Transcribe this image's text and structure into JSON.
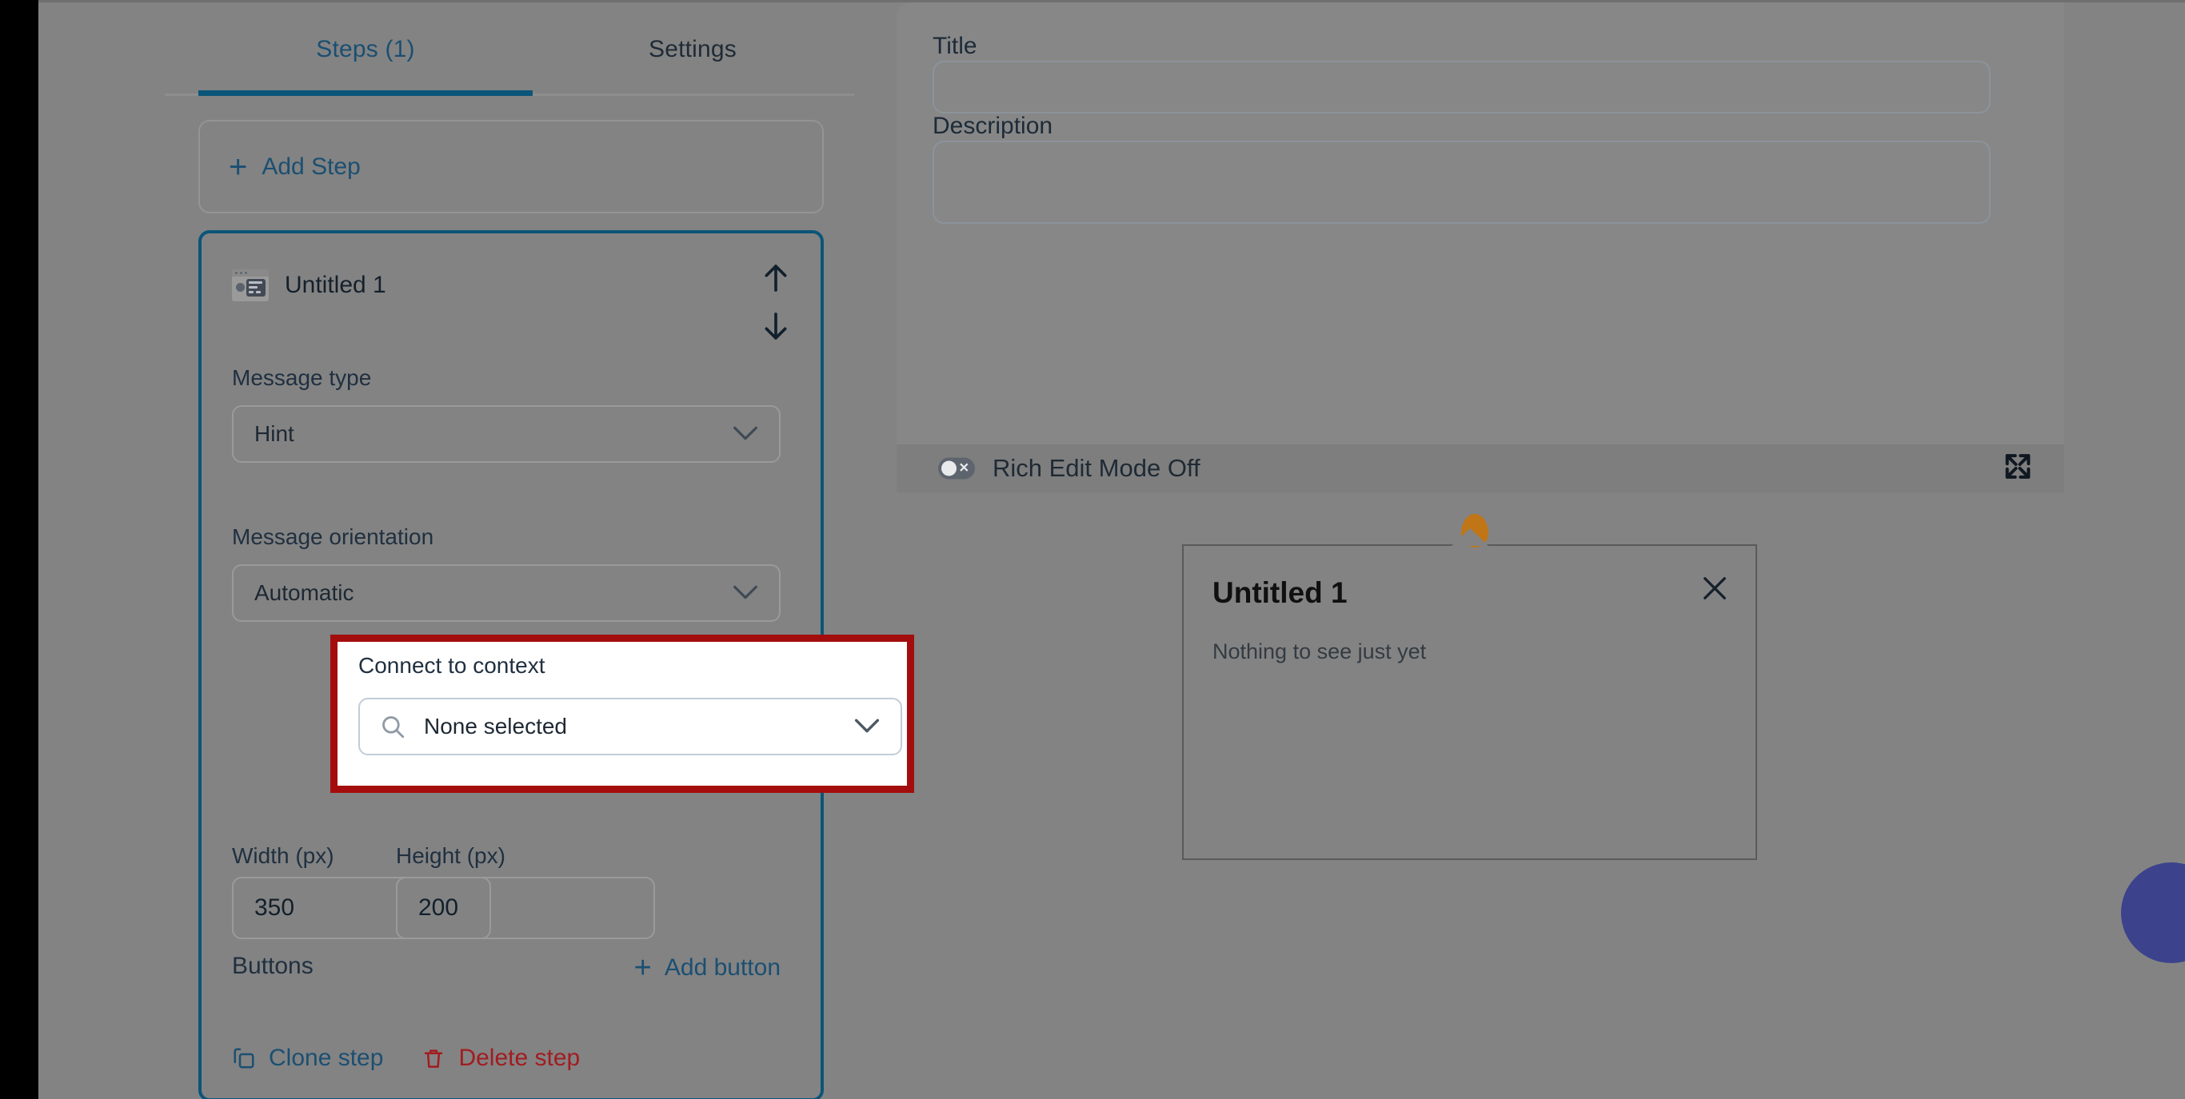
{
  "tabs": [
    {
      "label": "Steps (1)",
      "active": true
    },
    {
      "label": "Settings",
      "active": false
    }
  ],
  "left_panel": {
    "add_step_label": "Add Step",
    "step": {
      "name": "Untitled 1",
      "icon": "hint-window-icon",
      "move_up_icon": "arrow-up-icon",
      "move_down_icon": "arrow-down-icon",
      "message_type": {
        "label": "Message type",
        "value": "Hint"
      },
      "message_orientation": {
        "label": "Message orientation",
        "value": "Automatic"
      },
      "connect_to_context": {
        "label": "Connect to context",
        "value": "None selected",
        "search_icon": "search-icon",
        "highlighted": true,
        "highlight_color": "#a40d0d"
      },
      "width": {
        "label": "Width (px)",
        "value": "350"
      },
      "height": {
        "label": "Height (px)",
        "value": "200"
      },
      "buttons_label": "Buttons",
      "add_button_label": "Add button",
      "clone_step_label": "Clone step",
      "delete_step_label": "Delete step"
    }
  },
  "right_panel": {
    "title": {
      "label": "Title",
      "value": ""
    },
    "description": {
      "label": "Description",
      "value": ""
    },
    "rich_edit": {
      "label": "Rich Edit Mode Off",
      "state": "off",
      "expand_icon": "expand-fullscreen-icon"
    },
    "preview": {
      "pin_color": "#c07516",
      "popup_title": "Untitled 1",
      "popup_body": "Nothing to see just yet",
      "close_icon": "close-icon"
    }
  },
  "colors": {
    "accent_blue": "#0b5579",
    "link_blue": "#1b4f72",
    "danger_red": "#a21c20",
    "highlight_red": "#a40d0d",
    "fab_blue": "#3c438c"
  }
}
